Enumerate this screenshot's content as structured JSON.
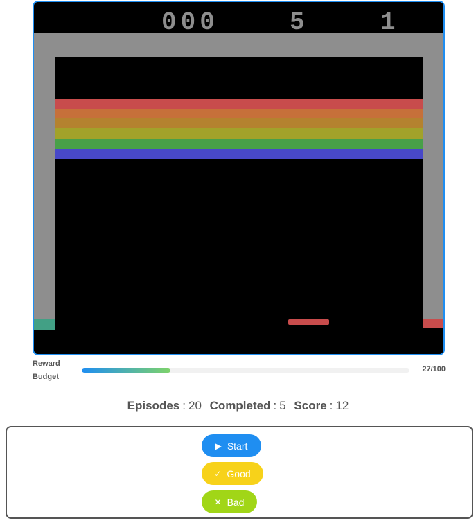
{
  "game": {
    "score_display": "000",
    "lives_display": "5",
    "player_display": "1",
    "colors": {
      "wall": "#8e8e8e",
      "background": "#000000",
      "brick_rows": [
        "#c84c4c",
        "#c6703a",
        "#b4822f",
        "#a2a22a",
        "#48a048",
        "#4848c8"
      ],
      "paddle": "#c84c4c",
      "left_wall_bottom": "#42a085",
      "right_wall_bottom": "#c84c4c",
      "frame_border": "#1f8ef1"
    }
  },
  "reward_budget": {
    "label_line1": "Reward",
    "label_line2": "Budget",
    "value_text": "27/100",
    "fraction": 0.27
  },
  "stats": {
    "episodes_label": "Episodes",
    "episodes_value": "20",
    "completed_label": "Completed",
    "completed_value": "5",
    "score_label": "Score",
    "score_value": "12"
  },
  "controls": {
    "start_label": "Start",
    "start_icon": "play-icon",
    "good_label": "Good",
    "good_icon": "check-icon",
    "bad_label": "Bad",
    "bad_icon": "x-icon",
    "colors": {
      "start": "#1f8ef1",
      "good": "#f7d21a",
      "bad": "#a1d617"
    }
  }
}
